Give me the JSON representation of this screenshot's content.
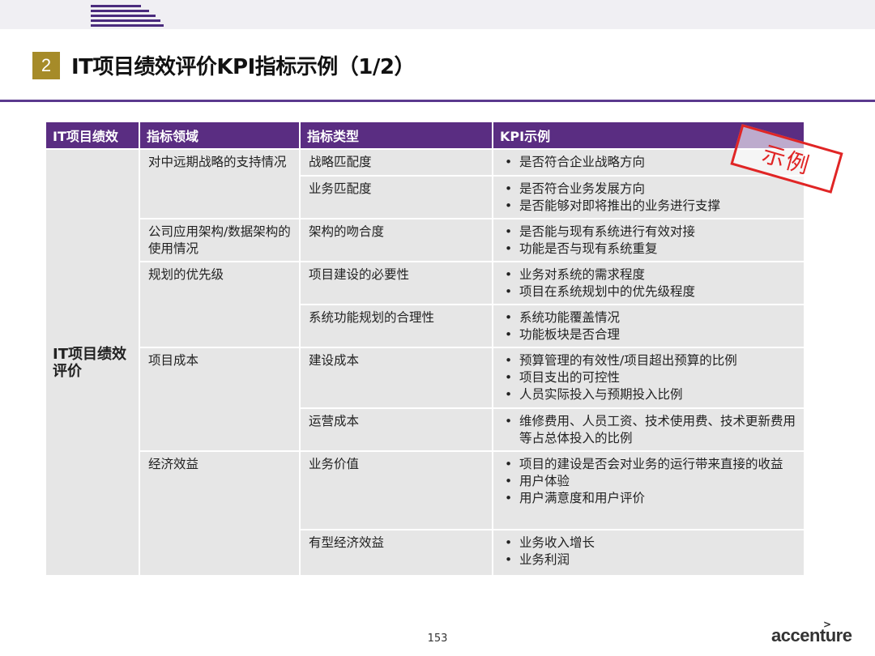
{
  "slide": {
    "number": "2",
    "title": "IT项目绩效评价KPI指标示例（1/2）",
    "stamp": "示例",
    "page": "153",
    "brand": "accenture",
    "brand_mark": ">"
  },
  "table": {
    "headers": [
      "IT项目绩效",
      "指标领域",
      "指标类型",
      "KPI示例"
    ],
    "first_col": "IT项目绩效评价",
    "rows": [
      {
        "domain": "对中远期战略的支持情况",
        "type": "战略匹配度",
        "kpis": [
          "是否符合企业战略方向"
        ]
      },
      {
        "domain": "",
        "type": "业务匹配度",
        "kpis": [
          "是否符合业务发展方向",
          "是否能够对即将推出的业务进行支撑"
        ]
      },
      {
        "domain": "公司应用架构/数据架构的使用情况",
        "type": "架构的吻合度",
        "kpis": [
          "是否能与现有系统进行有效对接",
          "功能是否与现有系统重复"
        ]
      },
      {
        "domain": "规划的优先级",
        "type": "项目建设的必要性",
        "kpis": [
          "业务对系统的需求程度",
          "项目在系统规划中的优先级程度"
        ]
      },
      {
        "domain": "",
        "type": "系统功能规划的合理性",
        "kpis": [
          "系统功能覆盖情况",
          "功能板块是否合理"
        ]
      },
      {
        "domain": "项目成本",
        "type": "建设成本",
        "kpis": [
          "预算管理的有效性/项目超出预算的比例",
          "项目支出的可控性",
          "人员实际投入与预期投入比例"
        ]
      },
      {
        "domain": "",
        "type": "运营成本",
        "kpis": [
          "维修费用、人员工资、技术使用费、技术更新费用等占总体投入的比例"
        ]
      },
      {
        "domain": "经济效益",
        "type": "业务价值",
        "kpis": [
          "项目的建设是否会对业务的运行带来直接的收益",
          "用户体验",
          "用户满意度和用户评价"
        ]
      },
      {
        "domain": "",
        "type": "有型经济效益",
        "kpis": [
          "业务收入增长",
          "业务利润"
        ]
      }
    ]
  },
  "colors": {
    "header_bg": "#5a2d82",
    "cell_bg": "#e6e6e6",
    "badge": "#a68b29",
    "rule": "#5b3a8e",
    "stamp": "#e02525"
  }
}
